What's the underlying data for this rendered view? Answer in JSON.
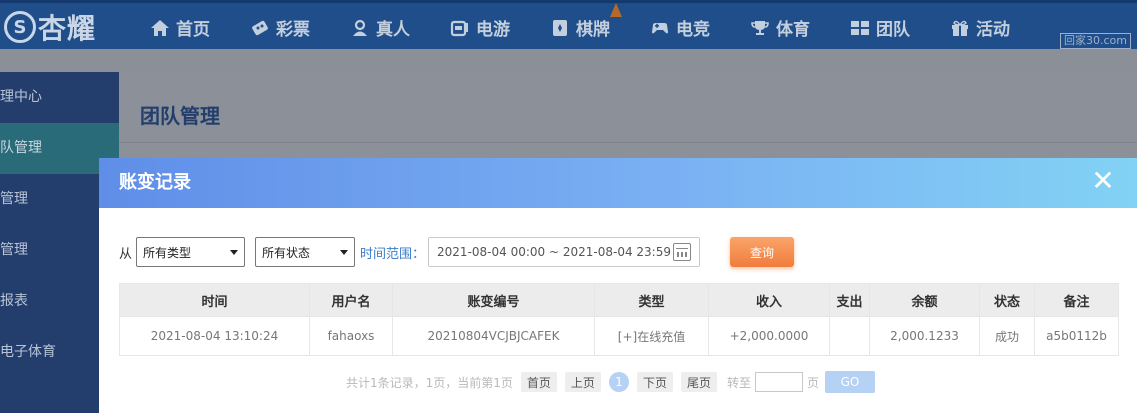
{
  "brand": {
    "logo_text": "杏耀",
    "logo_mark": "S"
  },
  "nav": {
    "items": [
      {
        "label": "首页",
        "icon": "home-icon"
      },
      {
        "label": "彩票",
        "icon": "lottery-icon"
      },
      {
        "label": "真人",
        "icon": "live-dealer-icon"
      },
      {
        "label": "电游",
        "icon": "slot-icon"
      },
      {
        "label": "棋牌",
        "icon": "cards-icon"
      },
      {
        "label": "电竞",
        "icon": "gamepad-icon"
      },
      {
        "label": "体育",
        "icon": "trophy-icon"
      },
      {
        "label": "团队",
        "icon": "team-icon"
      },
      {
        "label": "活动",
        "icon": "gift-icon"
      }
    ],
    "watermark": "回家30.com"
  },
  "sidebar": {
    "items": [
      {
        "label": "理中心"
      },
      {
        "label": "队管理"
      },
      {
        "label": "管理"
      },
      {
        "label": "管理"
      },
      {
        "label": "报表"
      },
      {
        "label": "电子体育"
      }
    ]
  },
  "page": {
    "title": "团队管理"
  },
  "modal": {
    "title": "账变记录",
    "close_symbol": "✕",
    "filters": {
      "from_label": "从",
      "type_select": "所有类型",
      "status_select": "所有状态",
      "range_label": "时间范围：",
      "date_range": "2021-08-04 00:00 ~ 2021-08-04 23:59",
      "query_label": "查询"
    },
    "table": {
      "headers": [
        "时间",
        "用户名",
        "账变编号",
        "类型",
        "收入",
        "支出",
        "余额",
        "状态",
        "备注"
      ],
      "rows": [
        [
          "2021-08-04 13:10:24",
          "fahaoxs",
          "20210804VCJBJCAFEK",
          "[+]在线充值",
          "+2,000.0000",
          "",
          "2,000.1233",
          "成功",
          "a5b0112b"
        ]
      ]
    },
    "pager": {
      "summary": "共计1条记录，1页，当前第1页",
      "first": "首页",
      "prev": "上页",
      "current": "1",
      "next": "下页",
      "last": "尾页",
      "goto_label": "转至",
      "page_unit": "页",
      "go": "GO"
    }
  },
  "colors": {
    "nav_bg": "#1f4e8a",
    "sidebar_bg": "#233e6c",
    "modal_header_start": "#5f8ee8",
    "modal_header_end": "#82d2f4",
    "query_button": "#f07c3c",
    "income_text": "#5f8f1a"
  }
}
